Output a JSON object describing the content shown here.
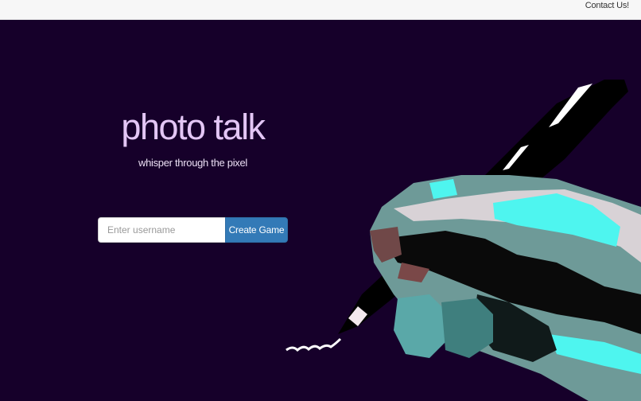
{
  "navbar": {
    "contact_label": "Contact Us!"
  },
  "hero": {
    "title": "photo talk",
    "subtitle": "whisper through the pixel"
  },
  "form": {
    "username_placeholder": "Enter username",
    "create_button_label": "Create Game"
  },
  "colors": {
    "background": "#16002a",
    "title": "#e3c6f5",
    "button": "#337ab7",
    "accent_cyan": "#4ef5ef"
  },
  "illustration": {
    "icon": "hand-holding-pen-icon"
  }
}
